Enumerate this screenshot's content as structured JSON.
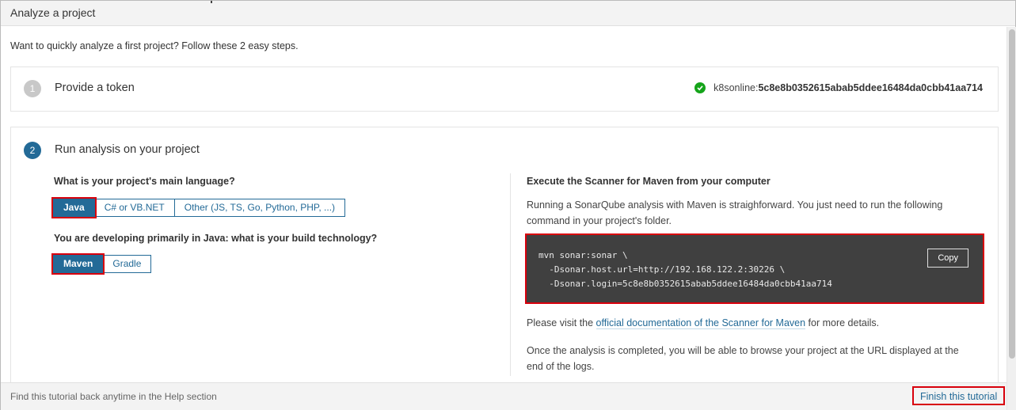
{
  "modal": {
    "title": "Analyze a project"
  },
  "intro": "Want to quickly analyze a first project? Follow these 2 easy steps.",
  "step1": {
    "number": "1",
    "title": "Provide a token",
    "token_name": "k8sonline:",
    "token_value": "5c8e8b0352615abab5ddee16484da0cbb41aa714"
  },
  "step2": {
    "number": "2",
    "title": "Run analysis on your project",
    "language_question": "What is your project's main language?",
    "languages": [
      "Java",
      "C# or VB.NET",
      "Other (JS, TS, Go, Python, PHP, ...)"
    ],
    "selected_language": "Java",
    "build_question": "You are developing primarily in Java: what is your build technology?",
    "builds": [
      "Maven",
      "Gradle"
    ],
    "selected_build": "Maven",
    "right_title": "Execute the Scanner for Maven from your computer",
    "right_intro": "Running a SonarQube analysis with Maven is straighforward. You just need to run the following command in your project's folder.",
    "command": "mvn sonar:sonar \\\n  -Dsonar.host.url=http://192.168.122.2:30226 \\\n  -Dsonar.login=5c8e8b0352615abab5ddee16484da0cbb41aa714",
    "copy_label": "Copy",
    "visit_prefix": "Please visit the ",
    "visit_link": "official documentation of the Scanner for Maven",
    "visit_suffix": " for more details.",
    "completed_text": "Once the analysis is completed, you will be able to browse your project at the URL displayed at the end of the logs."
  },
  "footer": {
    "hint": "Find this tutorial back anytime in the Help section",
    "finish_label": "Finish this tutorial"
  },
  "colors": {
    "accent": "#236a97",
    "highlight": "#d8000c",
    "success": "#15a41a",
    "code_bg": "#404040"
  }
}
